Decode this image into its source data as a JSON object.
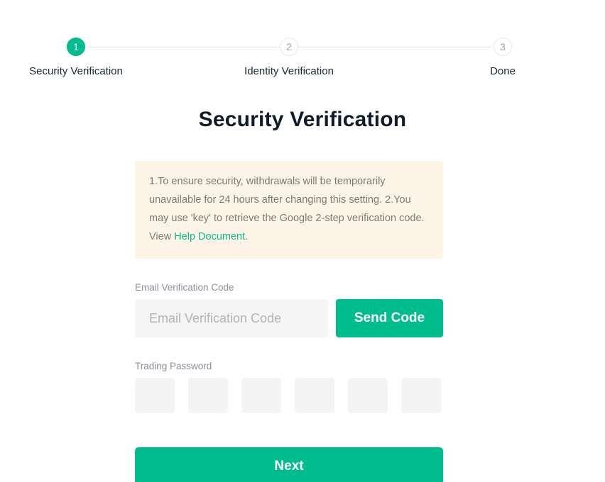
{
  "theme": {
    "accent": "#00bd8d",
    "notice_bg": "#fdf3e7",
    "input_bg": "#f5f5f5",
    "pin_bg": "#f4f4f4",
    "line": "#e8e8e8",
    "title_color": "#101c2b"
  },
  "stepper": {
    "steps": [
      {
        "number": "1",
        "label": "Security Verification",
        "state": "active"
      },
      {
        "number": "2",
        "label": "Identity Verification",
        "state": "inactive"
      },
      {
        "number": "3",
        "label": "Done",
        "state": "inactive"
      }
    ]
  },
  "page": {
    "title": "Security Verification"
  },
  "notice": {
    "line1": "1.To ensure security, withdrawals will be temporarily unavailable for 24 hours after changing this setting.",
    "line2_prefix": "2.You may use 'key' to retrieve the Google 2-step verification code. View ",
    "link_text": "Help Document",
    "line2_suffix": "."
  },
  "email_code": {
    "label": "Email Verification Code",
    "placeholder": "Email Verification Code",
    "value": "",
    "send_button": "Send Code"
  },
  "trading_password": {
    "label": "Trading Password",
    "digits": [
      "",
      "",
      "",
      "",
      "",
      ""
    ]
  },
  "actions": {
    "next_label": "Next"
  }
}
